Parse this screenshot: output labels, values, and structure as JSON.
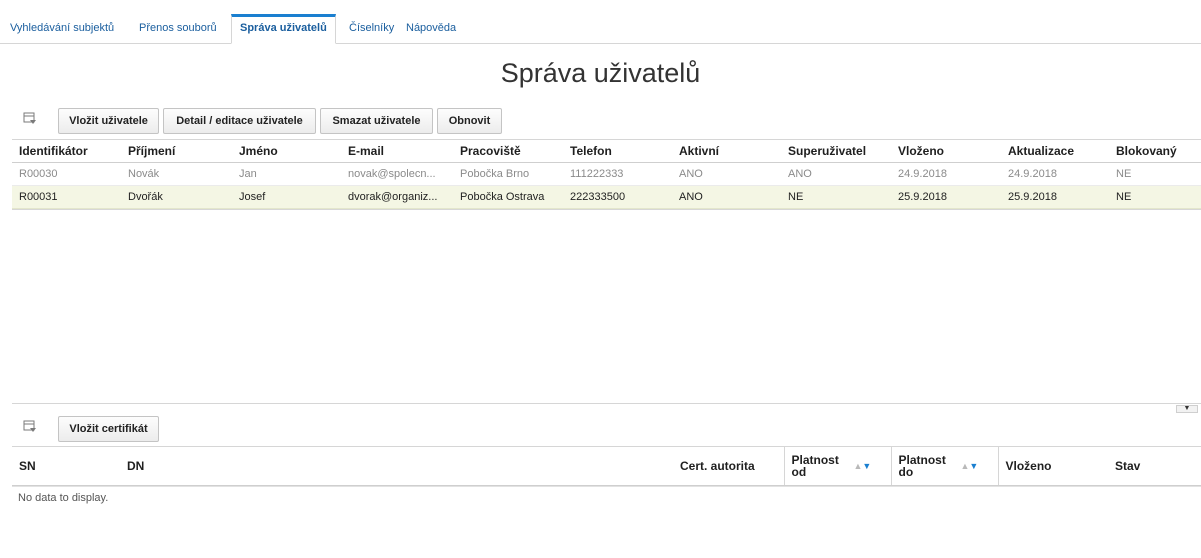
{
  "tabs": [
    {
      "label": "Vyhledávání subjektů",
      "active": false
    },
    {
      "label": "Přenos souborů",
      "active": false
    },
    {
      "label": "Správa uživatelů",
      "active": true
    },
    {
      "label": "Číselníky",
      "active": false
    },
    {
      "label": "Nápověda",
      "active": false
    }
  ],
  "page_title": "Správa uživatelů",
  "toolbar": {
    "icon": "column-chooser-icon",
    "insert_user": "Vložit uživatele",
    "detail_edit_user": "Detail / editace uživatele",
    "delete_user": "Smazat uživatele",
    "refresh": "Obnovit"
  },
  "users_table": {
    "columns": [
      "Identifikátor",
      "Příjmení",
      "Jméno",
      "E-mail",
      "Pracoviště",
      "Telefon",
      "Aktivní",
      "Superuživatel",
      "Vloženo",
      "Aktualizace",
      "Blokovaný"
    ],
    "rows": [
      [
        "R00030",
        "Novák",
        "Jan",
        "novak@spolecn...",
        "Pobočka Brno",
        "111222333",
        "ANO",
        "ANO",
        "24.9.2018",
        "24.9.2018",
        "NE"
      ],
      [
        "R00031",
        "Dvořák",
        "Josef",
        "dvorak@organiz...",
        "Pobočka Ostrava",
        "222333500",
        "ANO",
        "NE",
        "25.9.2018",
        "25.9.2018",
        "NE"
      ]
    ]
  },
  "cert_toolbar": {
    "icon": "column-chooser-icon",
    "insert_certificate": "Vložit certifikát"
  },
  "cert_table": {
    "columns": [
      "SN",
      "DN",
      "Cert. autorita",
      "Platnost od",
      "Platnost do",
      "Vloženo",
      "Stav"
    ],
    "empty_text": "No data to display."
  },
  "colors": {
    "accent": "#1a7fd0",
    "link": "#1a5e9e",
    "selected_row": "#f4f6e4"
  }
}
